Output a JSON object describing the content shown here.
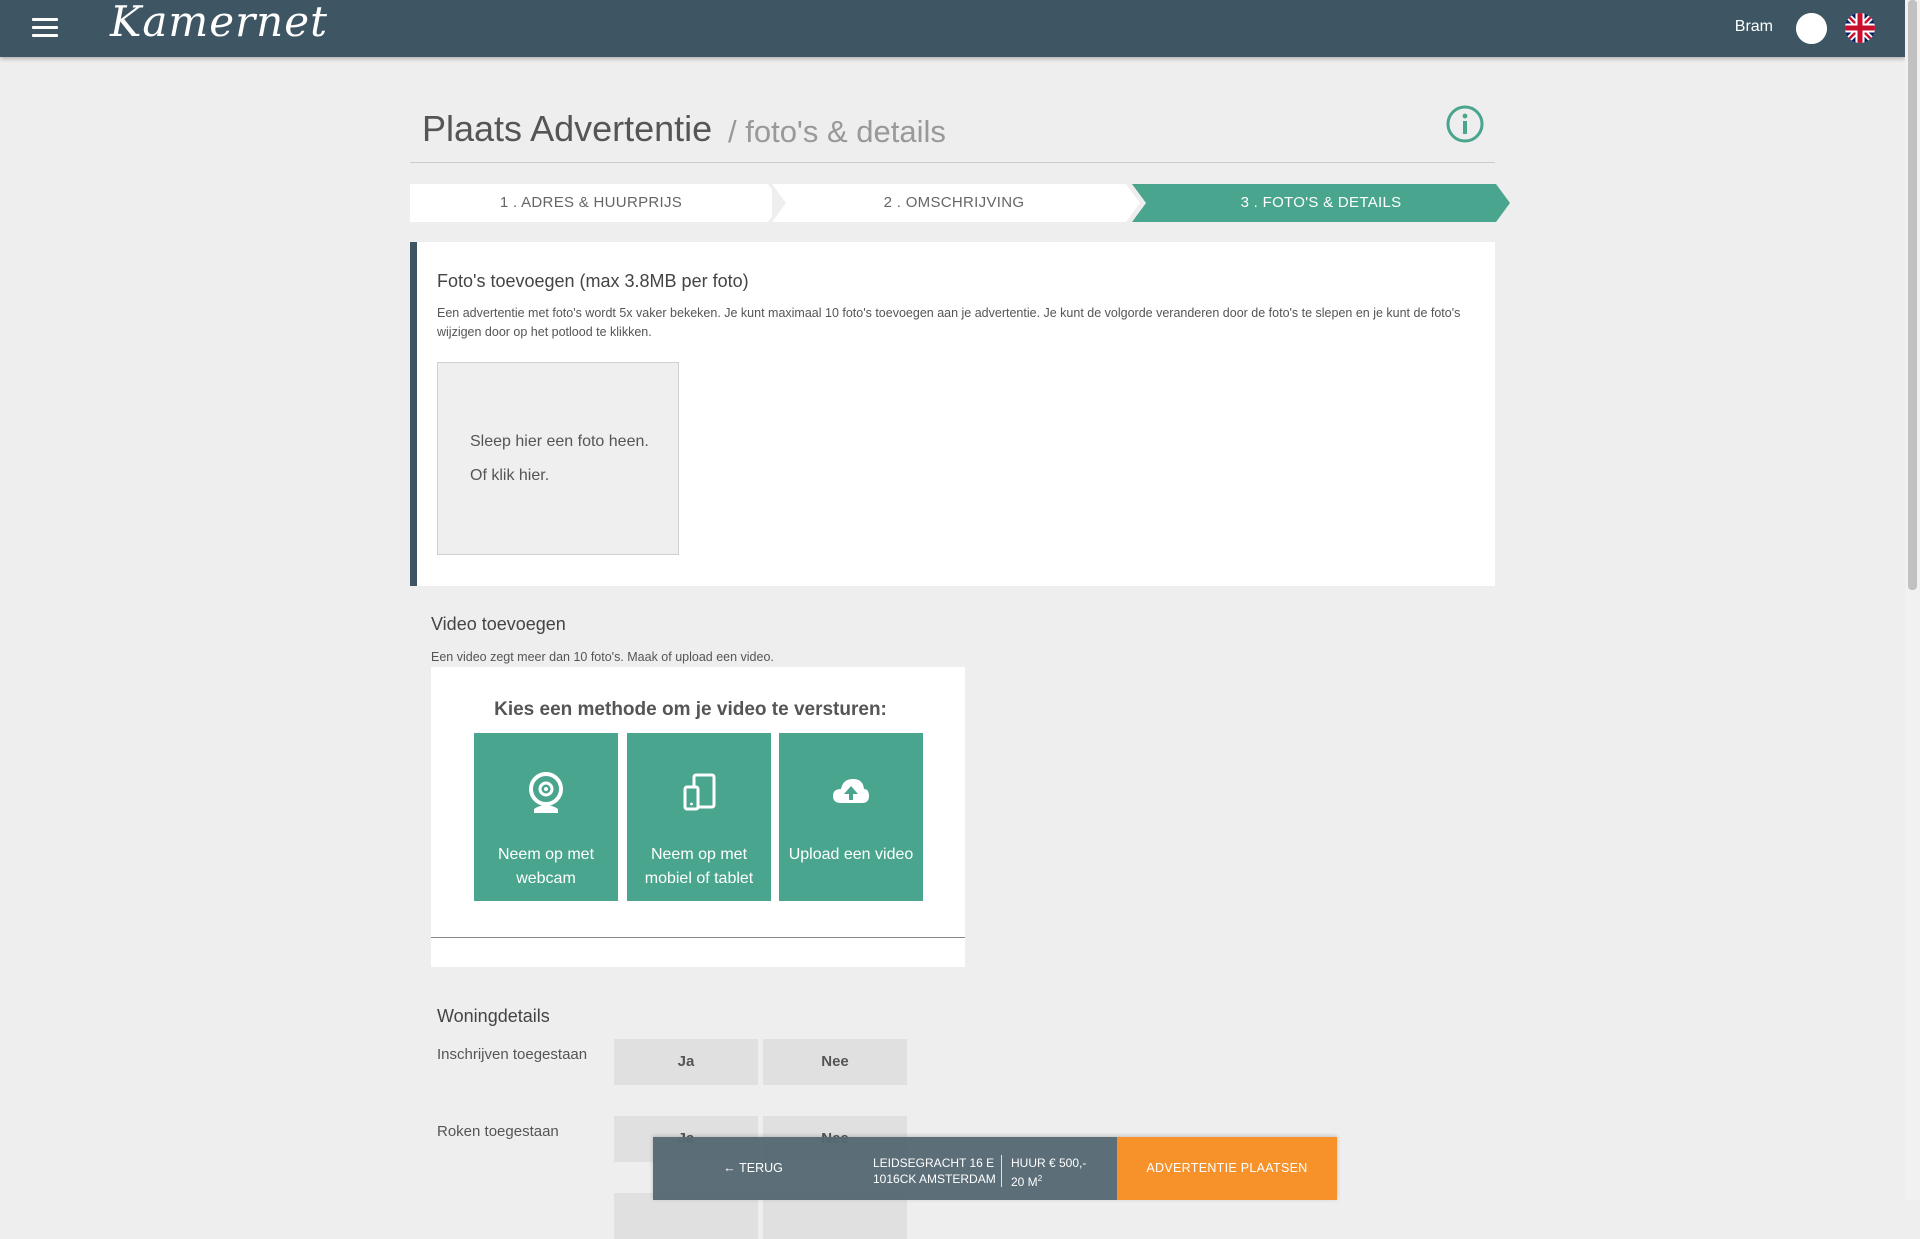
{
  "header": {
    "logo_text": "Kamernet",
    "user_name": "Bram"
  },
  "page": {
    "title": "Plaats Advertentie",
    "subtitle": "/ foto's & details"
  },
  "steps": [
    {
      "label": "1 . ADRES & HUURPRIJS",
      "active": false
    },
    {
      "label": "2 . OMSCHRIJVING",
      "active": false
    },
    {
      "label": "3 . FOTO'S & DETAILS",
      "active": true
    }
  ],
  "photos": {
    "title": "Foto's toevoegen (max 3.8MB per foto)",
    "description": "Een advertentie met foto's wordt 5x vaker bekeken. Je kunt maximaal 10 foto's toevoegen aan je advertentie. Je kunt de volgorde veranderen door de foto's te slepen en je kunt de foto's wijzigen door op het potlood te klikken.",
    "dropzone_line1": "Sleep hier een foto heen.",
    "dropzone_line2": "Of klik hier."
  },
  "video": {
    "title": "Video toevoegen",
    "description": "Een video zegt meer dan 10 foto's. Maak of upload een video.",
    "heading": "Kies een methode om je video te versturen:",
    "options": [
      {
        "line1": "Neem op met",
        "line2": "webcam",
        "icon": "webcam-icon"
      },
      {
        "line1": "Neem op met",
        "line2": "mobiel of tablet",
        "icon": "devices-icon"
      },
      {
        "line1": "Upload een video",
        "line2": "",
        "icon": "cloud-upload-icon"
      }
    ]
  },
  "details": {
    "title": "Woningdetails",
    "rows": [
      {
        "label": "Inschrijven toegestaan",
        "yes": "Ja",
        "no": "Nee"
      },
      {
        "label": "Roken toegestaan",
        "yes": "Ja",
        "no": "Nee"
      }
    ]
  },
  "bottom_bar": {
    "back_label": "TERUG",
    "address_line1": "LEIDSEGRACHT 16 E",
    "address_line2": "1016CK AMSTERDAM",
    "price_line1": "HUUR € 500,-",
    "price_line2": "20 M",
    "price_line2_sup": "2",
    "cta_label": "ADVERTENTIE PLAATSEN"
  },
  "colors": {
    "topbar": "#3e5663",
    "accent": "#4aa58e",
    "cta": "#f7922a"
  }
}
